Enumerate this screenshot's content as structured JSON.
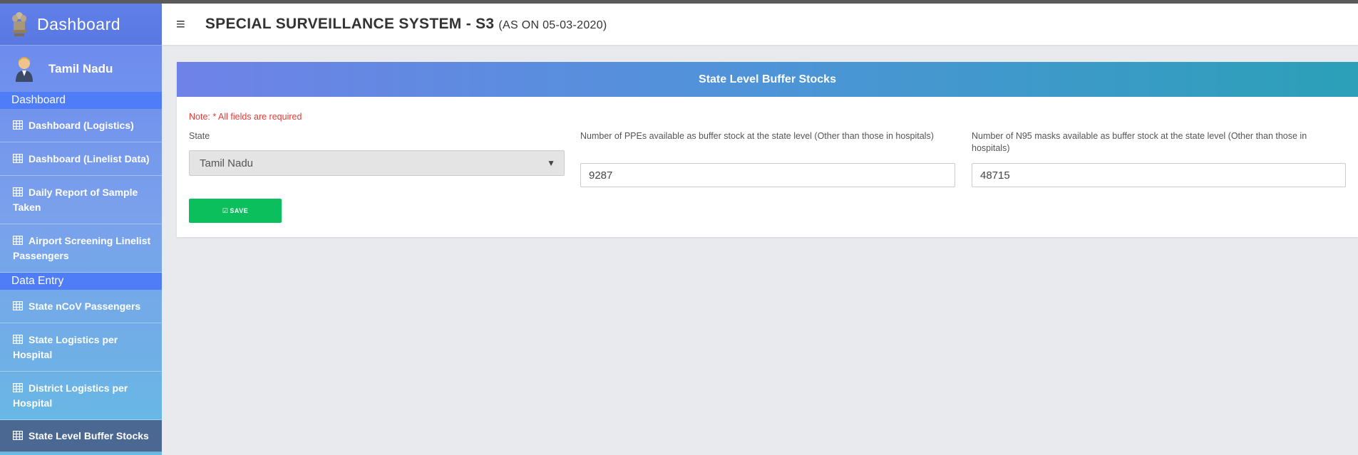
{
  "sidebar": {
    "brand_title": "Dashboard",
    "user_name": "Tamil Nadu",
    "sections": [
      {
        "heading": "Dashboard",
        "items": [
          {
            "label": "Dashboard (Logistics)"
          },
          {
            "label": "Dashboard (Linelist Data)"
          },
          {
            "label": "Daily Report of Sample Taken"
          },
          {
            "label": "Airport Screening Linelist Passengers"
          }
        ]
      },
      {
        "heading": "Data Entry",
        "items": [
          {
            "label": "State nCoV Passengers"
          },
          {
            "label": "State Logistics per Hospital"
          },
          {
            "label": "District Logistics per Hospital"
          },
          {
            "label": "State Level Buffer Stocks",
            "active": true
          }
        ]
      }
    ]
  },
  "header": {
    "title": "SPECIAL SURVEILLANCE SYSTEM - S3",
    "subtitle": "(AS ON 05-03-2020)"
  },
  "form": {
    "card_title": "State Level Buffer Stocks",
    "note": "Note: * All fields are required",
    "state_label": "State",
    "state_value": "Tamil Nadu",
    "ppe_label": "Number of PPEs available as buffer stock at the state level (Other than those in hospitals)",
    "ppe_value": "9287",
    "n95_label": "Number of N95 masks available as buffer stock at the state level (Other than those in hospitals)",
    "n95_value": "48715",
    "save_label": "SAVE"
  },
  "colors": {
    "sidebar_section": "#4f7cf7",
    "active_item": "#4b6893",
    "save_button": "#0bbf5c",
    "note_text": "#e53935"
  }
}
